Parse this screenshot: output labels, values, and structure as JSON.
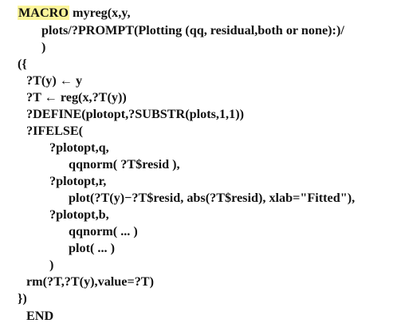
{
  "document": {
    "header": {
      "keyword": "MACRO",
      "rest": " myreg(x,y,"
    },
    "lines": [
      "plots/?PROMPT(Plotting (qq, residual,both or none):)/",
      ")",
      "({",
      "?T(y) ← y",
      "?T ← reg(x,?T(y))",
      "?DEFINE(plotopt,?SUBSTR(plots,1,1))",
      "?IFELSE(",
      "?plotopt,q,",
      "qqnorm( ?T$resid ),",
      "?plotopt,r,",
      "plot(?T(y)−?T$resid, abs(?T$resid), xlab=\"Fitted\"),",
      "?plotopt,b,",
      "qqnorm( ... )",
      "plot( ... )",
      ")",
      "rm(?T,?T(y),value=?T)",
      "})",
      "END"
    ],
    "highlight_color": "#fbf59b"
  }
}
